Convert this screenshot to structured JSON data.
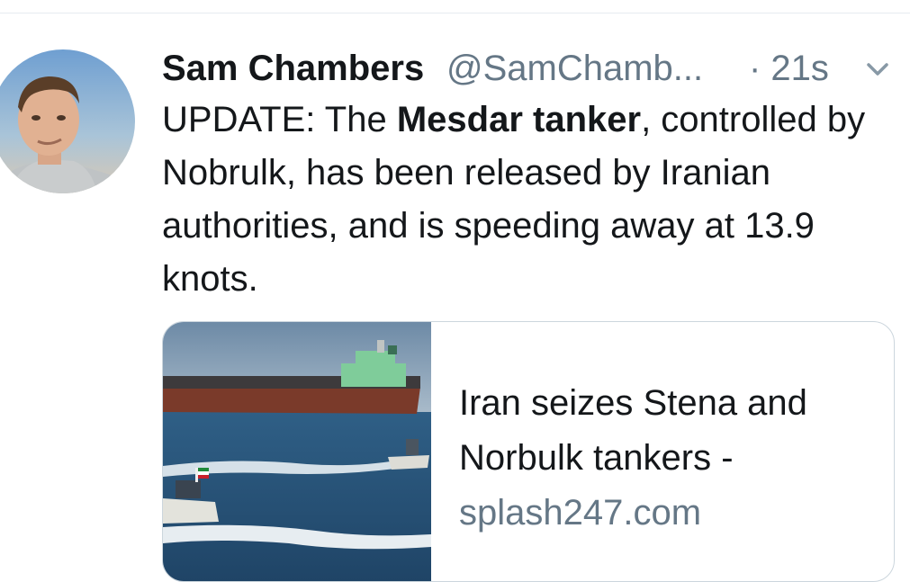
{
  "tweet": {
    "author_name": "Sam Chambers",
    "author_handle": "@SamChamb...",
    "timestamp": "· 21s",
    "text_before": "UPDATE: The ",
    "text_bold": "Mesdar tanker",
    "text_after": ", controlled by Nobrulk, has been released by Iranian authorities, and is speeding away at 13.9 knots.",
    "icons": {
      "menu": "chevron-down-icon"
    }
  },
  "link_card": {
    "title": "Iran seizes Stena and Norbulk tankers -",
    "domain": "splash247.com"
  },
  "colors": {
    "text": "#14171a",
    "secondary": "#657786",
    "border": "#ccd6dd"
  }
}
